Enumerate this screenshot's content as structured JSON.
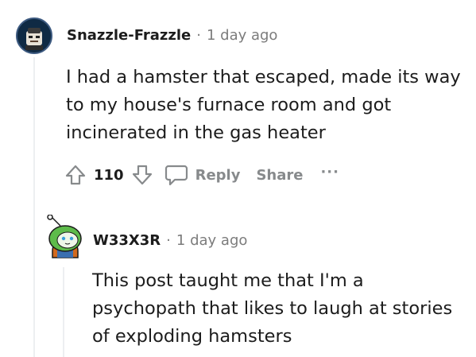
{
  "comments": [
    {
      "author": "Snazzle-Frazzle",
      "separator": "·",
      "time": "1 day ago",
      "body_lines": [
        "I had a hamster that escaped, made its way",
        "to my house's furnace room and got",
        "incinerated in the gas heater"
      ],
      "score": "110",
      "reply_label": "Reply",
      "share_label": "Share",
      "more_label": "···"
    },
    {
      "author": "W33X3R",
      "separator": "·",
      "time": "1 day ago",
      "body_lines": [
        "This post taught me that I'm a",
        "psychopath that likes to laugh at stories",
        "of exploding hamsters"
      ]
    }
  ],
  "colors": {
    "meta_gray": "#7c7c7c",
    "action_gray": "#878a8c",
    "thread_line": "#edeff1",
    "text": "#1c1c1c"
  }
}
